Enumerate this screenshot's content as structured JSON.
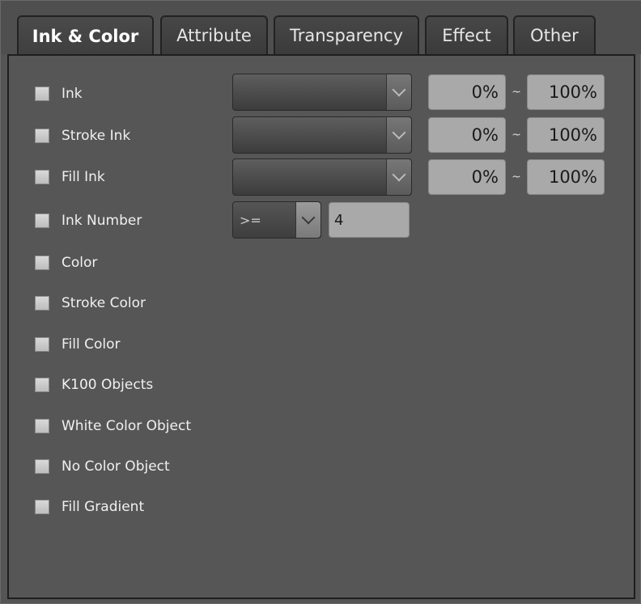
{
  "tabs": [
    {
      "label": "Ink & Color",
      "active": true
    },
    {
      "label": "Attribute",
      "active": false
    },
    {
      "label": "Transparency",
      "active": false
    },
    {
      "label": "Effect",
      "active": false
    },
    {
      "label": "Other",
      "active": false
    }
  ],
  "options": [
    {
      "label": "Ink",
      "checked": false
    },
    {
      "label": "Stroke Ink",
      "checked": false
    },
    {
      "label": "Fill Ink",
      "checked": false
    },
    {
      "label": "Ink Number",
      "checked": false
    },
    {
      "label": "Color",
      "checked": false
    },
    {
      "label": "Stroke Color",
      "checked": false
    },
    {
      "label": "Fill Color",
      "checked": false
    },
    {
      "label": "K100 Objects",
      "checked": false
    },
    {
      "label": "White Color Object",
      "checked": false
    },
    {
      "label": "No Color Object",
      "checked": false
    },
    {
      "label": "Fill Gradient",
      "checked": false
    }
  ],
  "ranges": [
    {
      "min": "0%",
      "sep": "~",
      "max": "100%"
    },
    {
      "min": "0%",
      "sep": "~",
      "max": "100%"
    },
    {
      "min": "0%",
      "sep": "~",
      "max": "100%"
    }
  ],
  "ink_number": {
    "operator": ">=",
    "value": "4"
  },
  "icons": {
    "dropdown_arrow": "chevron-down-icon",
    "checkbox": "checkbox-icon"
  }
}
